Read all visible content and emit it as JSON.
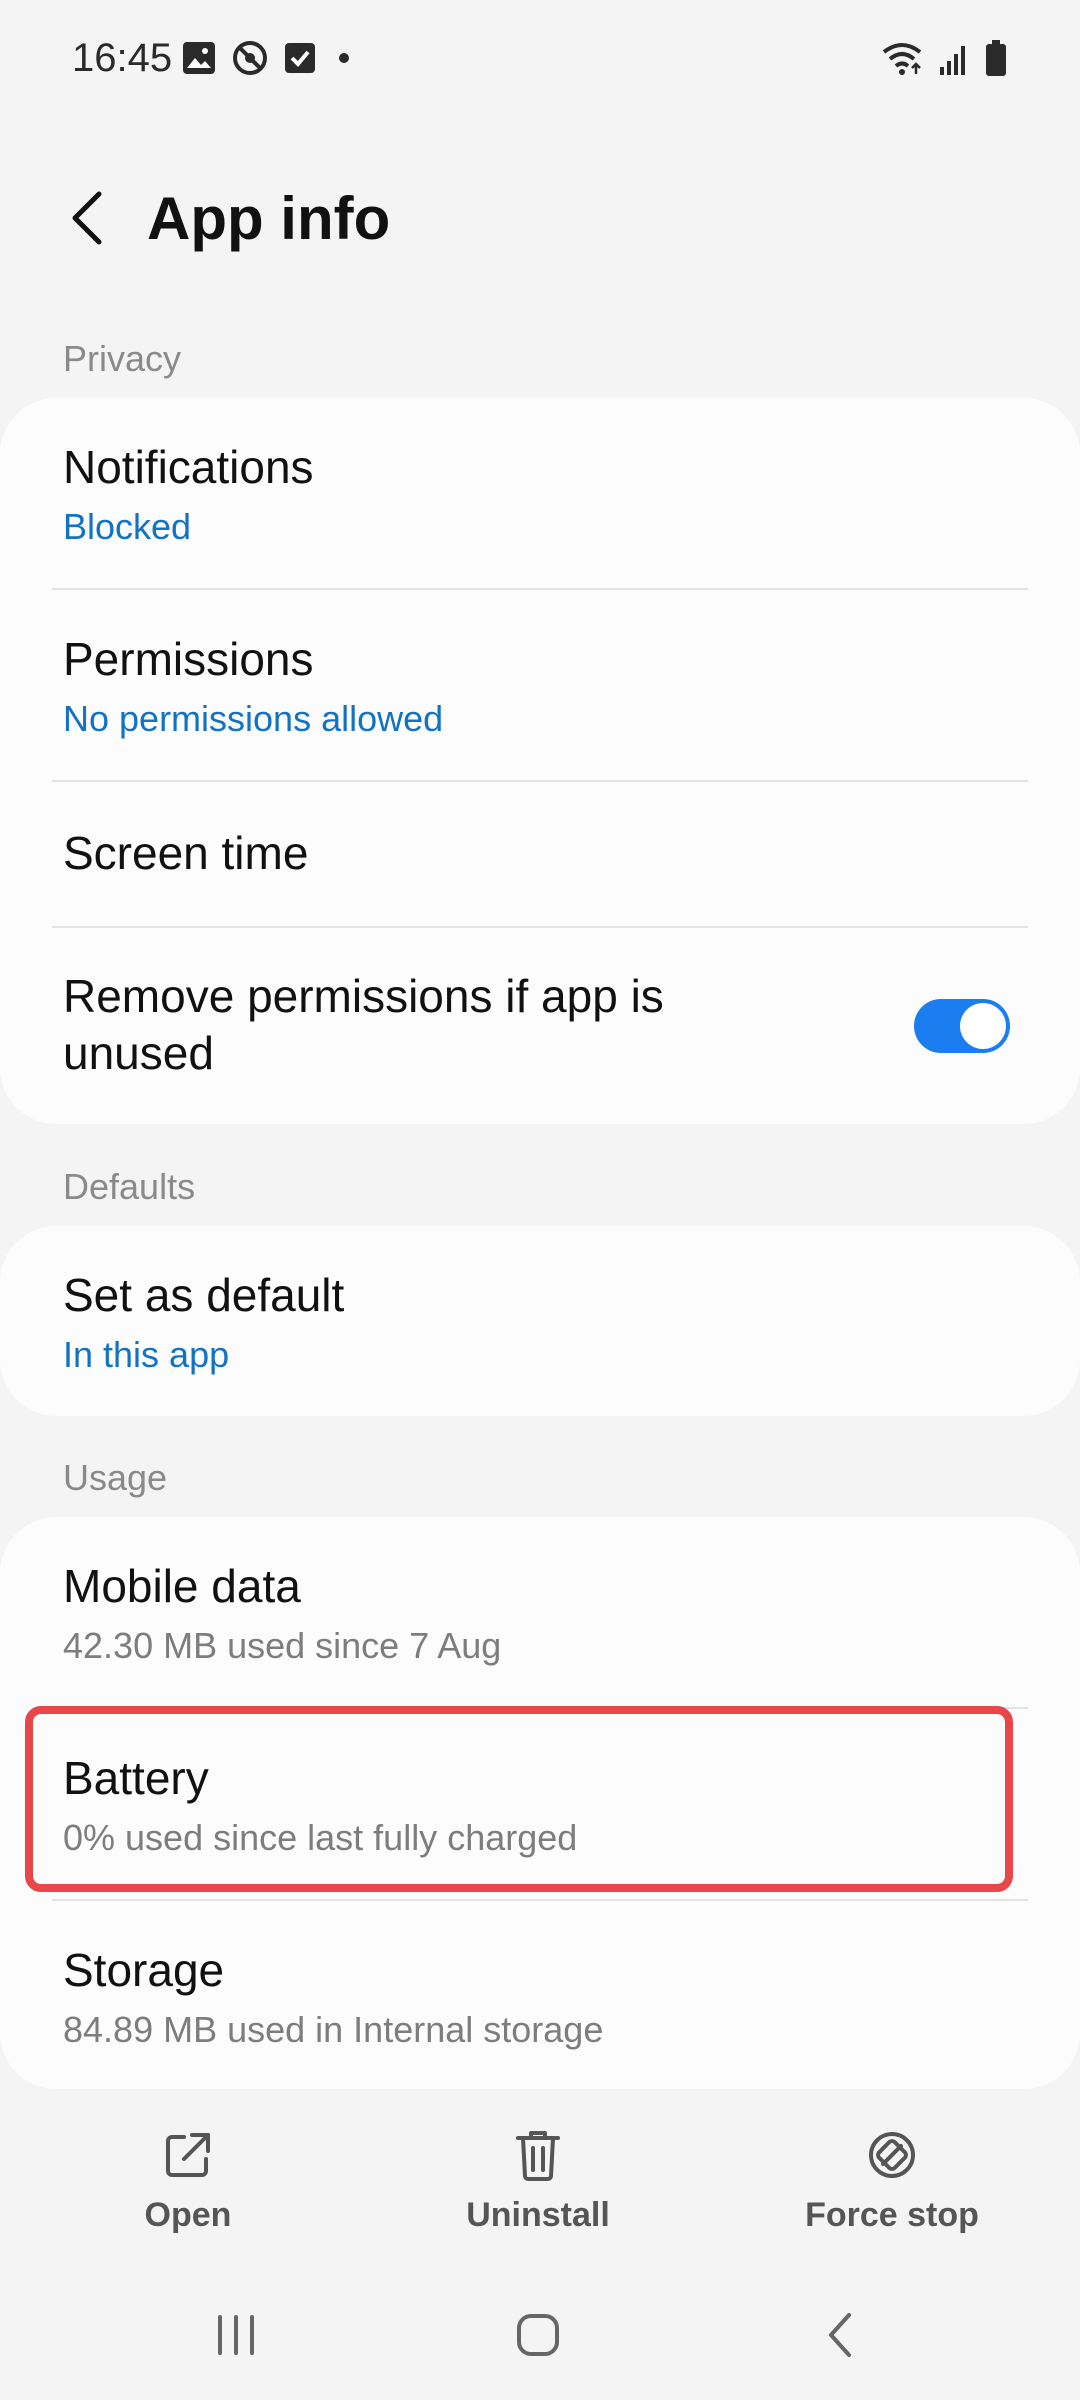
{
  "status_bar": {
    "time": "16:45",
    "left_icons": [
      "gallery-icon",
      "no-tracking-icon",
      "checkbox-icon",
      "dot-icon"
    ],
    "right_icons": [
      "wifi-icon",
      "signal-icon",
      "battery-icon"
    ]
  },
  "header": {
    "title": "App info"
  },
  "sections": {
    "privacy": {
      "label": "Privacy",
      "notifications": {
        "title": "Notifications",
        "subtitle": "Blocked"
      },
      "permissions": {
        "title": "Permissions",
        "subtitle": "No permissions allowed"
      },
      "screen_time": {
        "title": "Screen time"
      },
      "remove_permissions": {
        "title_line1": "Remove permissions if app is",
        "title_line2": "unused",
        "enabled": true
      }
    },
    "defaults": {
      "label": "Defaults",
      "set_as_default": {
        "title": "Set as default",
        "subtitle": "In this app"
      }
    },
    "usage": {
      "label": "Usage",
      "mobile_data": {
        "title": "Mobile data",
        "subtitle": "42.30 MB used since 7 Aug"
      },
      "battery": {
        "title": "Battery",
        "subtitle": "0% used since last fully charged"
      },
      "storage": {
        "title": "Storage",
        "subtitle": "84.89 MB used in Internal storage"
      }
    }
  },
  "bottom_actions": {
    "open": "Open",
    "uninstall": "Uninstall",
    "force_stop": "Force stop"
  },
  "colors": {
    "accent_blue": "#1273c4",
    "toggle_on": "#1a7ef0",
    "highlight_red": "#e8474a"
  }
}
